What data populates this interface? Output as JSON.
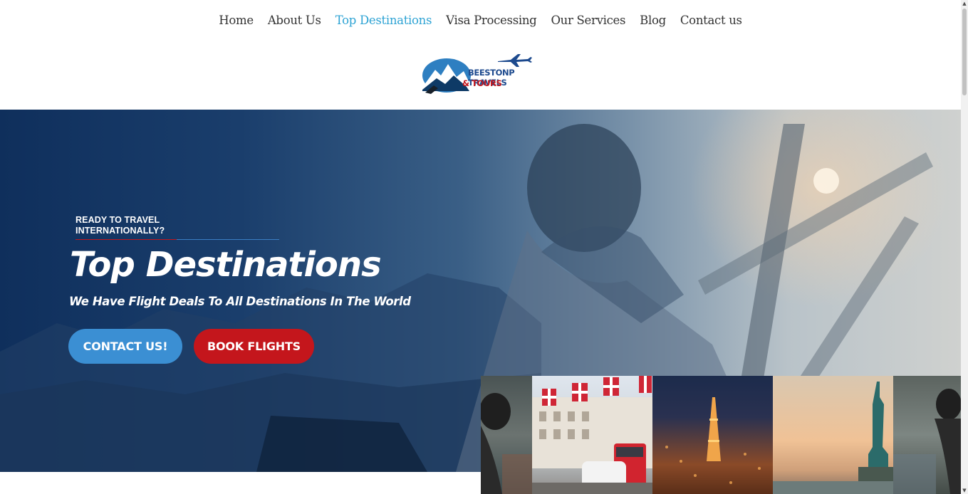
{
  "nav": {
    "items": [
      {
        "label": "Home",
        "active": false
      },
      {
        "label": "About Us",
        "active": false
      },
      {
        "label": "Top Destinations",
        "active": true
      },
      {
        "label": "Visa Processing",
        "active": false
      },
      {
        "label": "Our Services",
        "active": false
      },
      {
        "label": "Blog",
        "active": false
      },
      {
        "label": "Contact us",
        "active": false
      }
    ],
    "active_color": "#2ea3d4"
  },
  "logo": {
    "line1": "BEESTONP TRAVELS",
    "line2": "& TOURS",
    "icon": "airplane-icon"
  },
  "hero": {
    "eyebrow": "READY TO TRAVEL INTERNATIONALLY?",
    "title": "Top Destinations",
    "subtitle": "We Have Flight Deals To All Destinations In The World",
    "buttons": {
      "contact": "CONTACT US!",
      "book": "BOOK FLIGHTS"
    }
  },
  "gallery": {
    "tiles": [
      "statue-fountain",
      "london-street",
      "paris-night",
      "statue-of-liberty",
      "statue-fountain"
    ]
  },
  "colors": {
    "brand_blue": "#3b8fd3",
    "brand_red": "#c4161c",
    "hero_dark": "#0f2f5c"
  }
}
